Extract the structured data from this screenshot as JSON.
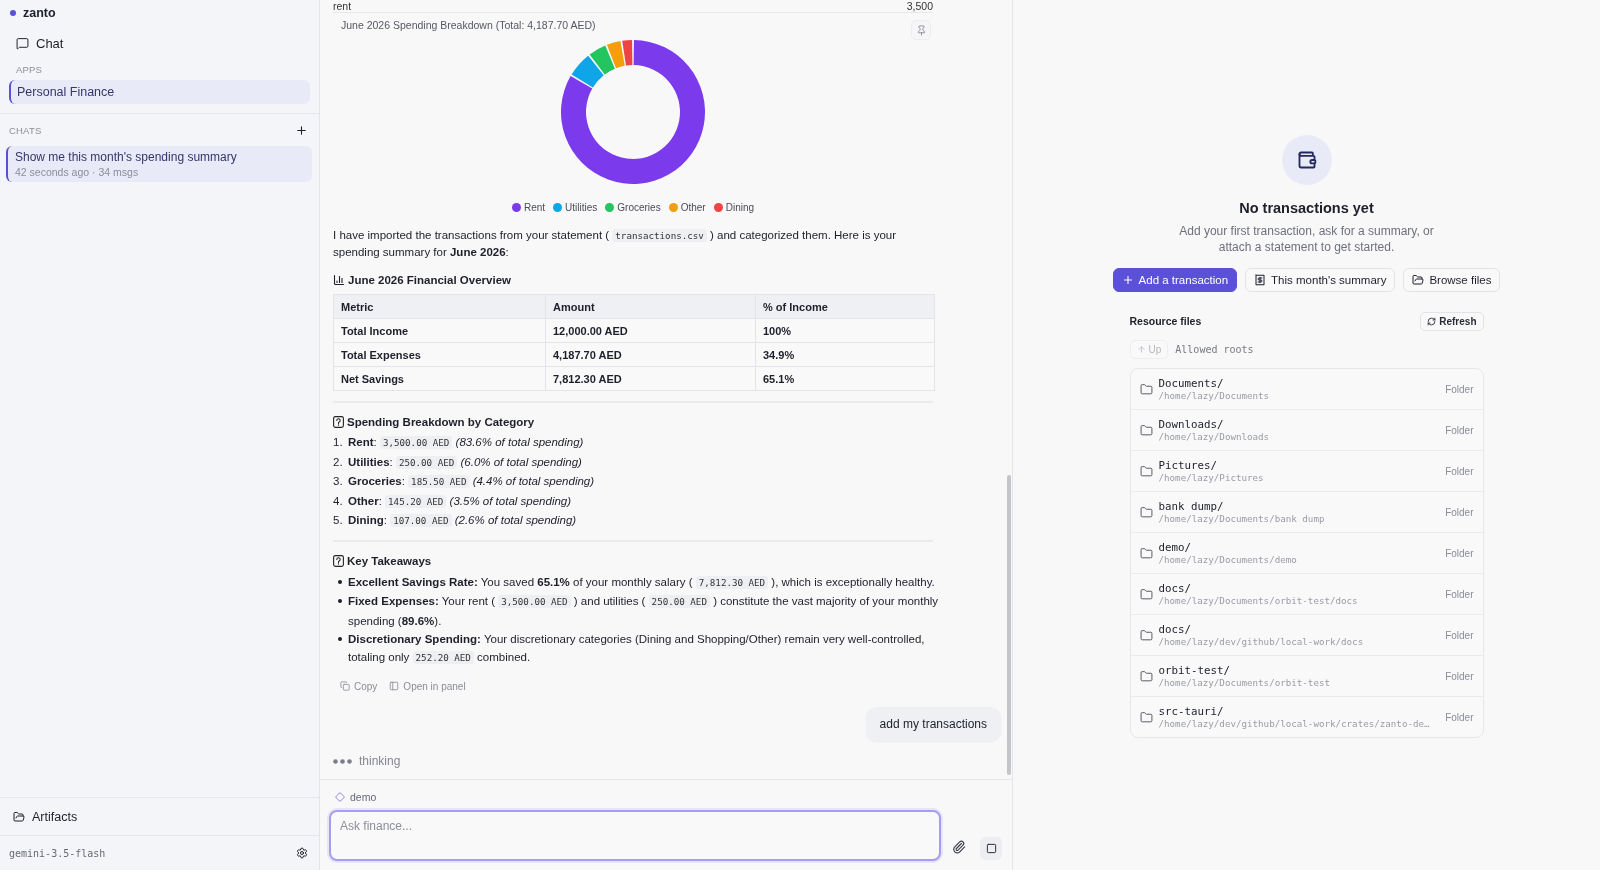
{
  "sidebar": {
    "brand": "zanto",
    "nav": [
      {
        "label": "Chat"
      }
    ],
    "apps_label": "APPS",
    "apps": [
      {
        "label": "Personal Finance",
        "selected": true
      }
    ],
    "chats_label": "CHATS",
    "chats": [
      {
        "title": "Show me this month's spending summary",
        "meta": "42 seconds ago · 34 msgs",
        "selected": true
      }
    ],
    "footer_nav": [
      {
        "label": "Artifacts"
      }
    ],
    "model": "gemini-3.5-flash"
  },
  "conversation": {
    "previous_row": {
      "label": "rent",
      "value": "3,500"
    },
    "chart": {
      "chart_data": {
        "type": "donut",
        "title": "June 2026 Spending Breakdown (Total: 4,187.70 AED)",
        "categories": [
          "Rent",
          "Utilities",
          "Groceries",
          "Other",
          "Dining"
        ],
        "values": [
          83.6,
          6.0,
          4.4,
          3.5,
          2.6
        ],
        "colors": [
          "#7c3aed",
          "#0ea5e9",
          "#22c55e",
          "#f59e0b",
          "#ef4444"
        ],
        "legend": "bottom"
      }
    },
    "intro": [
      {
        "kind": "text",
        "text": "I have imported the transactions from your statement ( "
      },
      {
        "kind": "code",
        "text": "transactions.csv"
      },
      {
        "kind": "text",
        "text": " ) and categorized them. Here is your spending summary for **June 2026**:"
      }
    ],
    "overview": {
      "title": "June 2026 Financial Overview",
      "columns": [
        "Metric",
        "Amount",
        "% of Income"
      ],
      "rows": [
        [
          "Total Income",
          "12,000.00 AED",
          "100%"
        ],
        [
          "Total Expenses",
          "4,187.70 AED",
          "34.9%"
        ],
        [
          "Net Savings",
          "7,812.30 AED",
          "65.1%"
        ]
      ]
    },
    "breakdown": {
      "title": "Spending Breakdown by Category",
      "items": [
        {
          "marker": "1.",
          "parts": [
            {
              "kind": "text",
              "text": "**Rent**: "
            },
            {
              "kind": "code",
              "text": "3,500.00 AED"
            },
            {
              "kind": "text",
              "text": " *(83.6% of total spending)*"
            }
          ]
        },
        {
          "marker": "2.",
          "parts": [
            {
              "kind": "text",
              "text": "**Utilities**: "
            },
            {
              "kind": "code",
              "text": "250.00 AED"
            },
            {
              "kind": "text",
              "text": " *(6.0% of total spending)*"
            }
          ]
        },
        {
          "marker": "3.",
          "parts": [
            {
              "kind": "text",
              "text": "**Groceries**: "
            },
            {
              "kind": "code",
              "text": "185.50 AED"
            },
            {
              "kind": "text",
              "text": " *(4.4% of total spending)*"
            }
          ]
        },
        {
          "marker": "4.",
          "parts": [
            {
              "kind": "text",
              "text": "**Other**: "
            },
            {
              "kind": "code",
              "text": "145.20 AED"
            },
            {
              "kind": "text",
              "text": " *(3.5% of total spending)*"
            }
          ]
        },
        {
          "marker": "5.",
          "parts": [
            {
              "kind": "text",
              "text": "**Dining**: "
            },
            {
              "kind": "code",
              "text": "107.00 AED"
            },
            {
              "kind": "text",
              "text": " *(2.6% of total spending)*"
            }
          ]
        }
      ]
    },
    "takeaways": {
      "title": "Key Takeaways",
      "items": [
        {
          "parts": [
            {
              "kind": "text",
              "text": "**Excellent Savings Rate:** You saved **65.1%** of your monthly salary ( "
            },
            {
              "kind": "code",
              "text": "7,812.30 AED"
            },
            {
              "kind": "text",
              "text": " ), which is exceptionally healthy."
            }
          ]
        },
        {
          "parts": [
            {
              "kind": "text",
              "text": "**Fixed Expenses:** Your rent ( "
            },
            {
              "kind": "code",
              "text": "3,500.00 AED"
            },
            {
              "kind": "text",
              "text": " ) and utilities ( "
            },
            {
              "kind": "code",
              "text": "250.00 AED"
            },
            {
              "kind": "text",
              "text": " ) constitute the vast majority of your monthly spending (**89.6%**)."
            }
          ]
        },
        {
          "parts": [
            {
              "kind": "text",
              "text": "**Discretionary Spending:** Your discretionary categories (Dining and Shopping/Other) remain very well-controlled, totaling only "
            },
            {
              "kind": "code",
              "text": "252.20 AED"
            },
            {
              "kind": "text",
              "text": " combined."
            }
          ]
        }
      ]
    },
    "actions": [
      {
        "label": "Copy",
        "kind": "copy"
      },
      {
        "label": "Open in panel",
        "kind": "panel"
      }
    ],
    "user_message": "add my transactions",
    "status": {
      "label": "thinking"
    }
  },
  "composer": {
    "tag": "demo",
    "placeholder": "Ask finance..."
  },
  "empty_state": {
    "title": "No transactions yet",
    "description": "Add your first transaction, ask for a summary, or attach a statement to get started.",
    "actions": [
      {
        "label": "Add a transaction",
        "kind": "add",
        "primary": true
      },
      {
        "label": "This month's summary",
        "kind": "summary",
        "primary": false
      },
      {
        "label": "Browse files",
        "kind": "browse",
        "primary": false
      }
    ]
  },
  "resources": {
    "title": "Resource files",
    "refresh": "Refresh",
    "up": {
      "label": "Up",
      "disabled": true
    },
    "location": "Allowed roots",
    "files": [
      {
        "name": "Documents/",
        "path": "/home/lazy/Documents",
        "type": "Folder"
      },
      {
        "name": "Downloads/",
        "path": "/home/lazy/Downloads",
        "type": "Folder"
      },
      {
        "name": "Pictures/",
        "path": "/home/lazy/Pictures",
        "type": "Folder"
      },
      {
        "name": "bank dump/",
        "path": "/home/lazy/Documents/bank dump",
        "type": "Folder"
      },
      {
        "name": "demo/",
        "path": "/home/lazy/Documents/demo",
        "type": "Folder"
      },
      {
        "name": "docs/",
        "path": "/home/lazy/Documents/orbit-test/docs",
        "type": "Folder"
      },
      {
        "name": "docs/",
        "path": "/home/lazy/dev/github/local-work/docs",
        "type": "Folder"
      },
      {
        "name": "orbit-test/",
        "path": "/home/lazy/Documents/orbit-test",
        "type": "Folder"
      },
      {
        "name": "src-tauri/",
        "path": "/home/lazy/dev/github/local-work/crates/zanto-de…",
        "type": "Folder"
      }
    ]
  }
}
